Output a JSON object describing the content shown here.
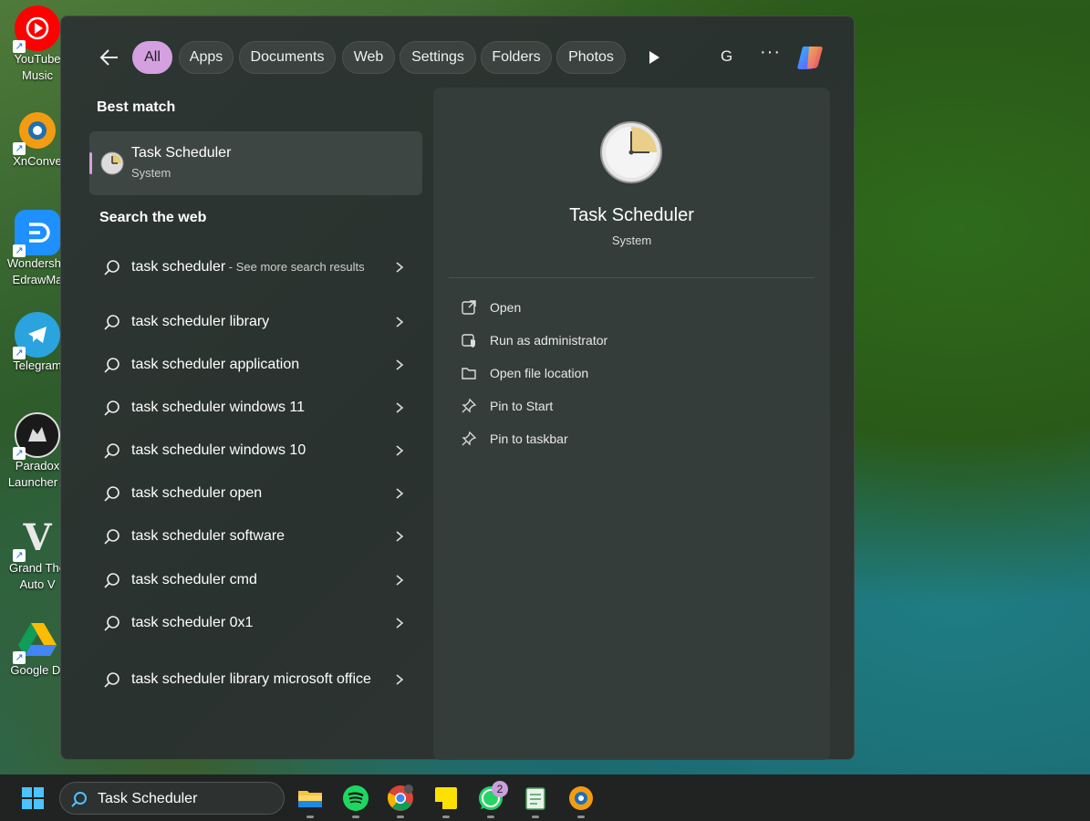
{
  "desktop": {
    "icons": [
      {
        "label": "YouTube\nMusic",
        "icon": "youtube-music-icon",
        "color": "#ff0000"
      },
      {
        "label": "XnConve",
        "icon": "xnconvert-icon",
        "color": "#f39c12"
      },
      {
        "label": "Wondersha\nEdrawMa",
        "icon": "edrawmax-icon",
        "color": "#1e90ff"
      },
      {
        "label": "Telegram",
        "icon": "telegram-icon",
        "color": "#2aa3df"
      },
      {
        "label": "Paradox\nLauncher v",
        "icon": "paradox-launcher-icon",
        "color": "#222222"
      },
      {
        "label": "Grand The\nAuto V",
        "icon": "gta-v-icon",
        "color": "#2b2b2b"
      },
      {
        "label": "Google Dr",
        "icon": "google-drive-icon",
        "color": "#ffffff"
      }
    ]
  },
  "search_panel": {
    "filters": [
      "All",
      "Apps",
      "Documents",
      "Web",
      "Settings",
      "Folders",
      "Photos"
    ],
    "active_filter": "All",
    "account_initial": "G",
    "more_label": "···",
    "best_match_heading": "Best match",
    "best_match": {
      "title": "Task Scheduler",
      "subtitle": "System"
    },
    "search_web_heading": "Search the web",
    "web_results": [
      {
        "text": "task scheduler",
        "suffix": " - See more search results"
      },
      {
        "text": "task scheduler library",
        "suffix": ""
      },
      {
        "text": "task scheduler application",
        "suffix": ""
      },
      {
        "text": "task scheduler windows 11",
        "suffix": ""
      },
      {
        "text": "task scheduler windows 10",
        "suffix": ""
      },
      {
        "text": "task scheduler open",
        "suffix": ""
      },
      {
        "text": "task scheduler software",
        "suffix": ""
      },
      {
        "text": "task scheduler cmd",
        "suffix": ""
      },
      {
        "text": "task scheduler 0x1",
        "suffix": ""
      },
      {
        "text": "task scheduler library microsoft office",
        "suffix": ""
      }
    ],
    "preview": {
      "title": "Task Scheduler",
      "subtitle": "System",
      "actions": [
        "Open",
        "Run as administrator",
        "Open file location",
        "Pin to Start",
        "Pin to taskbar"
      ]
    }
  },
  "taskbar": {
    "search_value": "Task Scheduler",
    "apps": [
      "file-explorer",
      "spotify",
      "chrome",
      "sticky-notes",
      "whatsapp",
      "notepad",
      "xnconvert"
    ],
    "whatsapp_badge": "2"
  },
  "colors": {
    "accent": "#d4a0e0",
    "panel": "#2e3633",
    "preview": "#353d3a"
  }
}
